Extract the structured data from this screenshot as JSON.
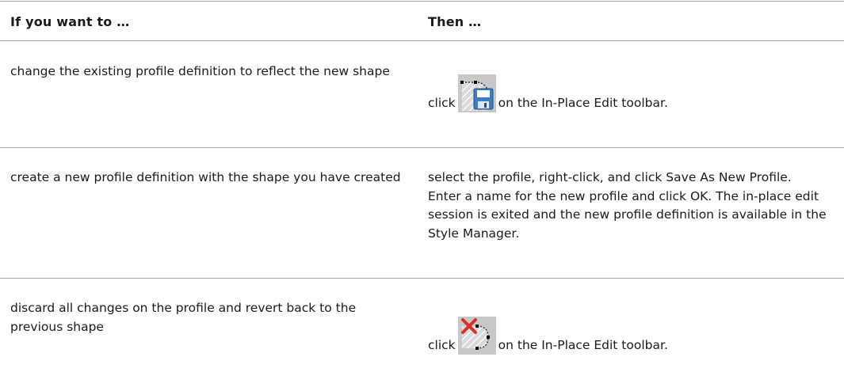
{
  "header": {
    "col1": "If you want to …",
    "col2": "Then …"
  },
  "rows": [
    {
      "want": "change the existing profile definition to reflect the new shape",
      "then_prefix": "click",
      "then_icon": "save-profile-icon",
      "then_suffix": "on the In-Place Edit toolbar."
    },
    {
      "want": "create a new profile definition with the shape you have created",
      "then_text": "select the profile, right-click, and click Save As New Profile. Enter a name for the new profile and click OK. The in-place edit session is exited and the new profile definition is available in the Style Manager."
    },
    {
      "want": "discard all changes on the profile and revert back to the previous shape",
      "then_prefix": "click",
      "then_icon": "discard-changes-icon",
      "then_suffix": "on the In-Place Edit toolbar."
    }
  ]
}
